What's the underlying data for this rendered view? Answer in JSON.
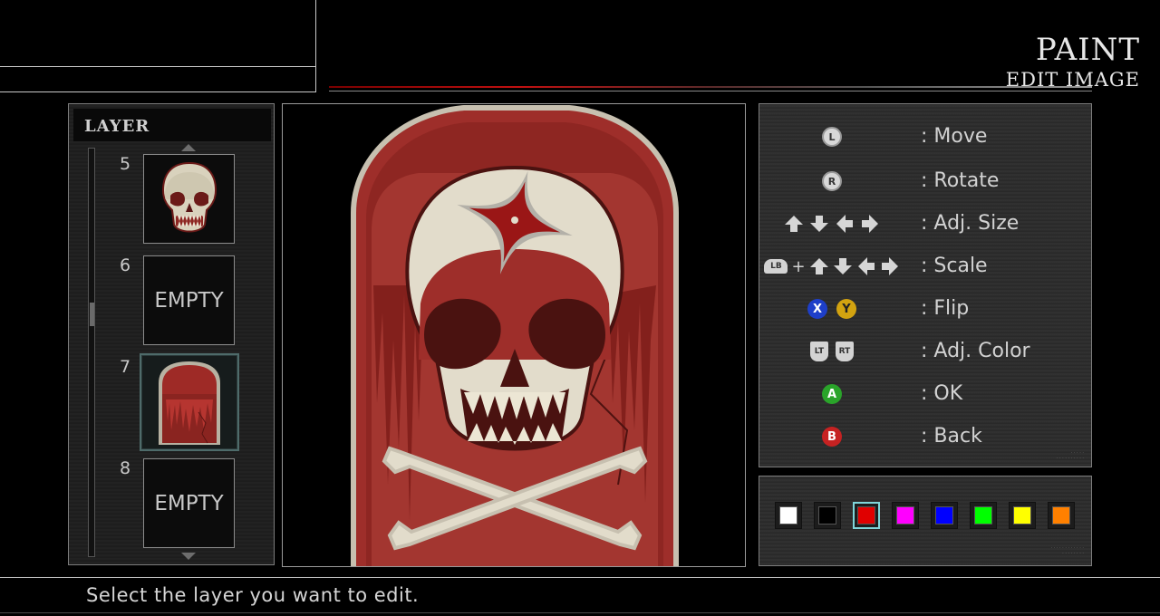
{
  "header": {
    "title": "PAINT",
    "subtitle": "EDIT IMAGE"
  },
  "layer_panel": {
    "heading": "LAYER",
    "layers": [
      {
        "number": "5",
        "content": "skull",
        "label": ""
      },
      {
        "number": "6",
        "content": "empty",
        "label": "EMPTY"
      },
      {
        "number": "7",
        "content": "tombstone",
        "label": "",
        "selected": true
      },
      {
        "number": "8",
        "content": "empty",
        "label": "EMPTY"
      }
    ]
  },
  "controls": {
    "rows": [
      {
        "icons": [
          "left-stick-icon"
        ],
        "glyphs": [
          "L"
        ],
        "label": ": Move"
      },
      {
        "icons": [
          "right-stick-icon"
        ],
        "glyphs": [
          "R"
        ],
        "label": ": Rotate"
      },
      {
        "icons": [
          "dpad-up-icon",
          "dpad-down-icon",
          "dpad-left-icon",
          "dpad-right-icon"
        ],
        "glyphs": [],
        "label": ": Adj. Size"
      },
      {
        "icons": [
          "lb-bumper-icon",
          "dpad-up-icon",
          "dpad-down-icon",
          "dpad-left-icon",
          "dpad-right-icon"
        ],
        "glyphs": [
          "LB",
          "+"
        ],
        "label": ": Scale"
      },
      {
        "icons": [
          "x-button-icon",
          "y-button-icon"
        ],
        "glyphs": [
          "X",
          "Y"
        ],
        "label": ": Flip"
      },
      {
        "icons": [
          "lt-trigger-icon",
          "rt-trigger-icon"
        ],
        "glyphs": [
          "LT",
          "RT"
        ],
        "label": ": Adj. Color"
      },
      {
        "icons": [
          "a-button-icon"
        ],
        "glyphs": [
          "A"
        ],
        "label": ": OK"
      },
      {
        "icons": [
          "b-button-icon"
        ],
        "glyphs": [
          "B"
        ],
        "label": ": Back"
      }
    ]
  },
  "palette": {
    "selected_index": 2,
    "colors": [
      "#ffffff",
      "#000000",
      "#e00000",
      "#ff00ff",
      "#0000ff",
      "#00ff00",
      "#ffff00",
      "#ff8000"
    ]
  },
  "footer": {
    "hint": "Select the layer you want to edit."
  },
  "theme": {
    "accent_red": "#c01010",
    "emblem_red": "#a8302c",
    "bone": "#e2dccb"
  }
}
